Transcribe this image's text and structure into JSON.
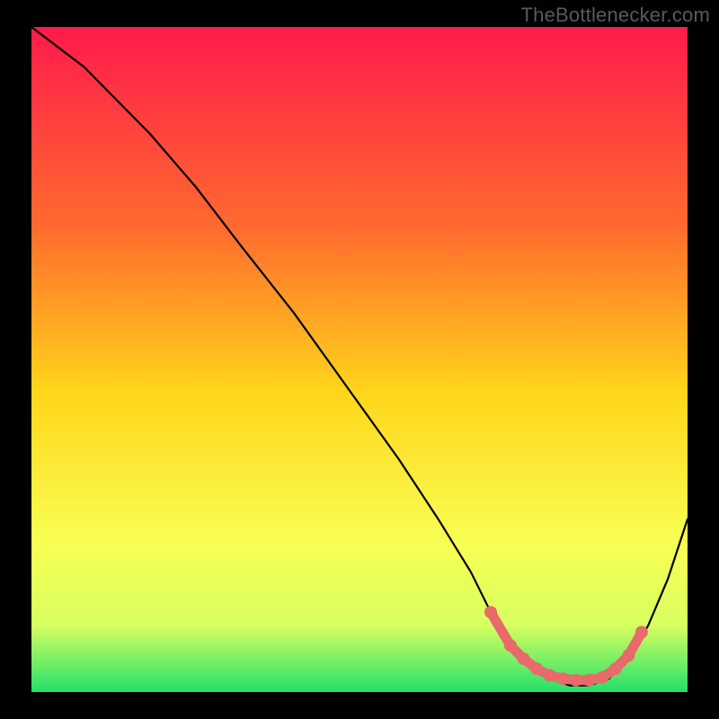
{
  "attribution": "TheBottlenecker.com",
  "colors": {
    "bg_black": "#000000",
    "curve": "#000000",
    "marker_fill": "#e86a6a",
    "marker_stroke": "#e86a6a",
    "grad_top": "#ff1a4b",
    "grad_mid1": "#ff6a2f",
    "grad_mid2": "#ffd61a",
    "grad_mid3": "#f8ff55",
    "grad_mid4": "#d7ff60",
    "grad_bottom": "#23e06a"
  },
  "chart_data": {
    "type": "line",
    "title": "",
    "xlabel": "",
    "ylabel": "",
    "xlim": [
      0,
      100
    ],
    "ylim": [
      0,
      100
    ],
    "series": [
      {
        "name": "bottleneck-curve",
        "x": [
          0,
          4,
          8,
          12,
          18,
          25,
          32,
          40,
          48,
          56,
          62,
          67,
          70,
          73,
          76,
          79,
          82,
          85,
          88,
          91,
          94,
          97,
          100
        ],
        "y": [
          100,
          97,
          94,
          90,
          84,
          76,
          67,
          57,
          46,
          35,
          26,
          18,
          12,
          7,
          4,
          2,
          1,
          1,
          2,
          5,
          10,
          17,
          26
        ]
      }
    ],
    "markers": {
      "name": "highlighted-points",
      "x": [
        70,
        73,
        75,
        77,
        79,
        81,
        83,
        85,
        87,
        89,
        91,
        93
      ],
      "y": [
        12,
        7,
        5,
        3.5,
        2.5,
        2,
        1.8,
        1.8,
        2.2,
        3.5,
        5.5,
        9
      ]
    }
  }
}
